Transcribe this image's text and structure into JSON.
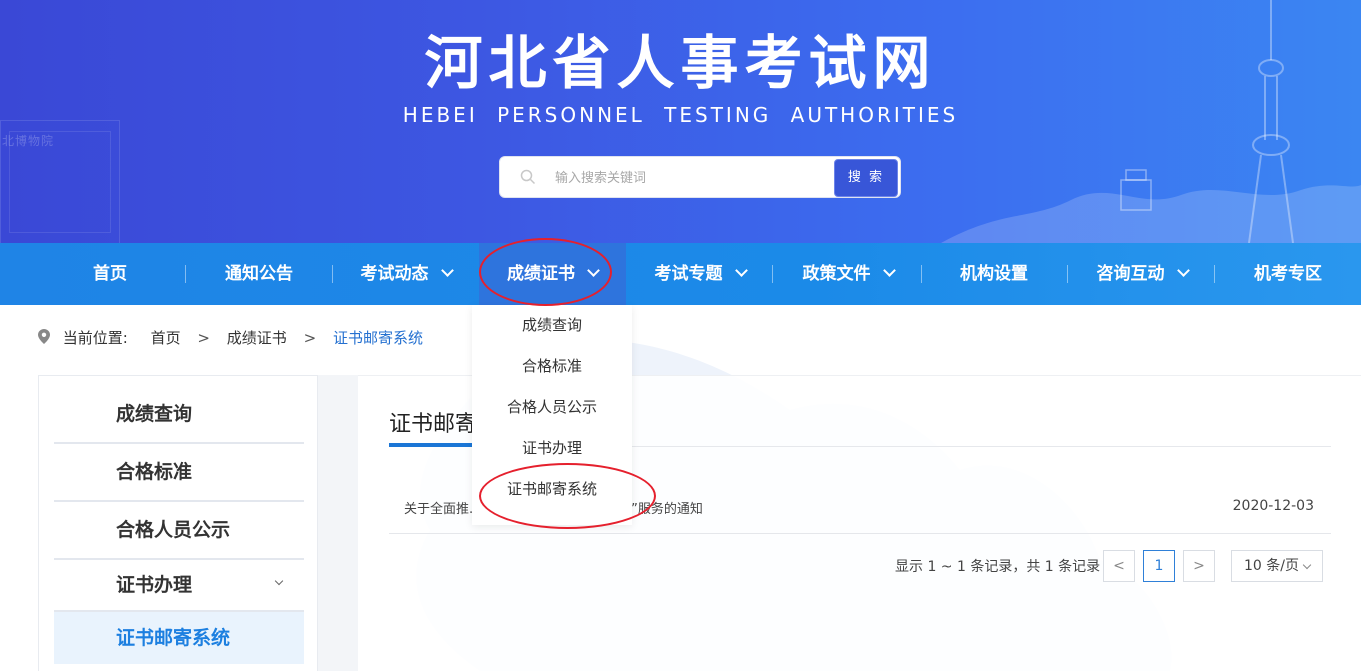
{
  "header": {
    "title": "河北省人事考试网",
    "subtitle": "HEBEI PERSONNEL TESTING AUTHORITIES",
    "search_placeholder": "输入搜索关键词",
    "search_button": "搜 索",
    "deco_text": "北博物院"
  },
  "nav": {
    "items": [
      {
        "label": "首页"
      },
      {
        "label": "通知公告"
      },
      {
        "label": "考试动态"
      },
      {
        "label": "成绩证书"
      },
      {
        "label": "考试专题"
      },
      {
        "label": "政策文件"
      },
      {
        "label": "机构设置"
      },
      {
        "label": "咨询互动"
      },
      {
        "label": "机考专区"
      }
    ]
  },
  "dropdown": {
    "items": [
      "成绩查询",
      "合格标准",
      "合格人员公示",
      "证书办理",
      "证书邮寄系统"
    ]
  },
  "breadcrumb": {
    "prefix": "当前位置:",
    "items": [
      "首页",
      "成绩证书",
      "证书邮寄系统"
    ],
    "separator": ">"
  },
  "sidebar": {
    "items": [
      "成绩查询",
      "合格标准",
      "合格人员公示",
      "证书办理",
      "证书邮寄系统"
    ]
  },
  "main": {
    "title": "证书邮寄",
    "articles": [
      {
        "title": "关于全面推...考试“证书邮寄、补办网申”服务的通知",
        "date": "2020-12-03"
      }
    ]
  },
  "pager": {
    "info": "显示 1 ~ 1 条记录，共 1 条记录",
    "prev": "<",
    "current": "1",
    "next": ">",
    "page_size": "10 条/页"
  },
  "colors": {
    "nav_bg": "#1f84e6",
    "accent": "#1b76d6",
    "highlight_ring": "#e5202d"
  }
}
